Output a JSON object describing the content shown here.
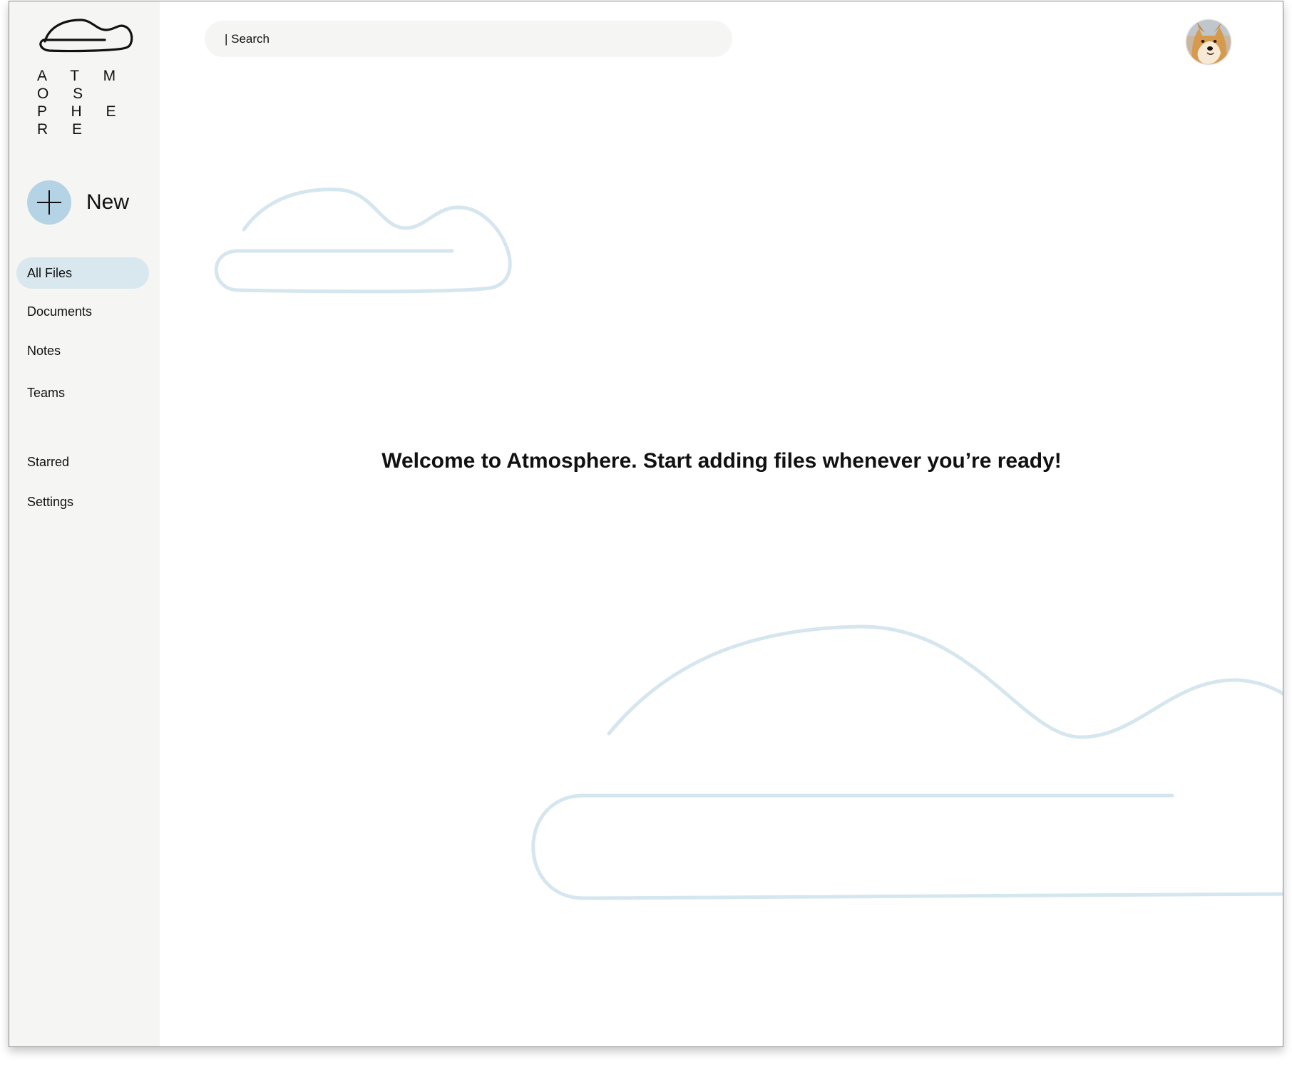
{
  "app": {
    "name_line1": "A T M O S",
    "name_line2": "P H E R E",
    "logo_icon": "cloud-logo-icon",
    "accent_color": "#b4d3e5",
    "sidebar_bg": "#f5f5f3",
    "active_nav_bg": "#d9e7ee",
    "cloud_outline_color": "#d6e6ef"
  },
  "sidebar": {
    "new_button": {
      "label": "New",
      "icon": "plus-icon"
    },
    "primary_items": [
      {
        "label": "All Files",
        "active": true
      },
      {
        "label": "Documents",
        "active": false
      },
      {
        "label": "Notes",
        "active": false
      },
      {
        "label": "Teams",
        "active": false
      }
    ],
    "secondary_items": [
      {
        "label": "Starred"
      },
      {
        "label": "Settings"
      }
    ]
  },
  "header": {
    "search": {
      "placeholder": "| Search",
      "value": ""
    },
    "avatar": {
      "icon": "user-avatar-shiba-dog"
    }
  },
  "main": {
    "welcome_message": "Welcome to Atmosphere. Start adding files whenever you’re ready!",
    "decorations": [
      "cloud-outline-icon",
      "cloud-outline-icon"
    ]
  }
}
